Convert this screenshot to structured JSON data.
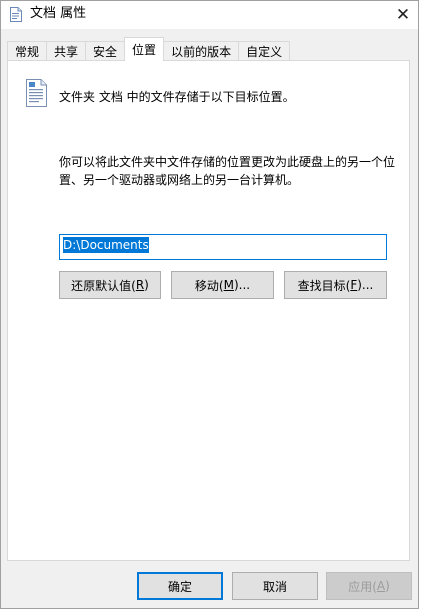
{
  "window": {
    "title": "文档 属性",
    "close_glyph": "✕"
  },
  "tabs": [
    {
      "label": "常规",
      "active": false
    },
    {
      "label": "共享",
      "active": false
    },
    {
      "label": "安全",
      "active": false
    },
    {
      "label": "位置",
      "active": true
    },
    {
      "label": "以前的版本",
      "active": false
    },
    {
      "label": "自定义",
      "active": false
    }
  ],
  "location": {
    "description": "文件夹 文档 中的文件存储于以下目标位置。",
    "explanation": "你可以将此文件夹中文件存储的位置更改为此硬盘上的另一个位置、另一个驱动器或网络上的另一台计算机。",
    "path_value": "D:\\Documents",
    "restore_button": {
      "text": "还原默认值(",
      "key": "R",
      "suffix": ")"
    },
    "move_button": {
      "text": "移动(",
      "key": "M",
      "suffix": ")..."
    },
    "find_button": {
      "text": "查找目标(",
      "key": "F",
      "suffix": ")..."
    }
  },
  "footer": {
    "ok_label": "确定",
    "cancel_label": "取消",
    "apply": {
      "text": "应用(",
      "key": "A",
      "suffix": ")"
    }
  },
  "icons": {
    "title_icon": "document-properties-icon",
    "folder_doc_icon": "document-icon"
  },
  "colors": {
    "accent": "#0078d7",
    "window_bg": "#f0f0f0",
    "panel_bg": "#ffffff",
    "button_bg": "#e1e1e1"
  }
}
